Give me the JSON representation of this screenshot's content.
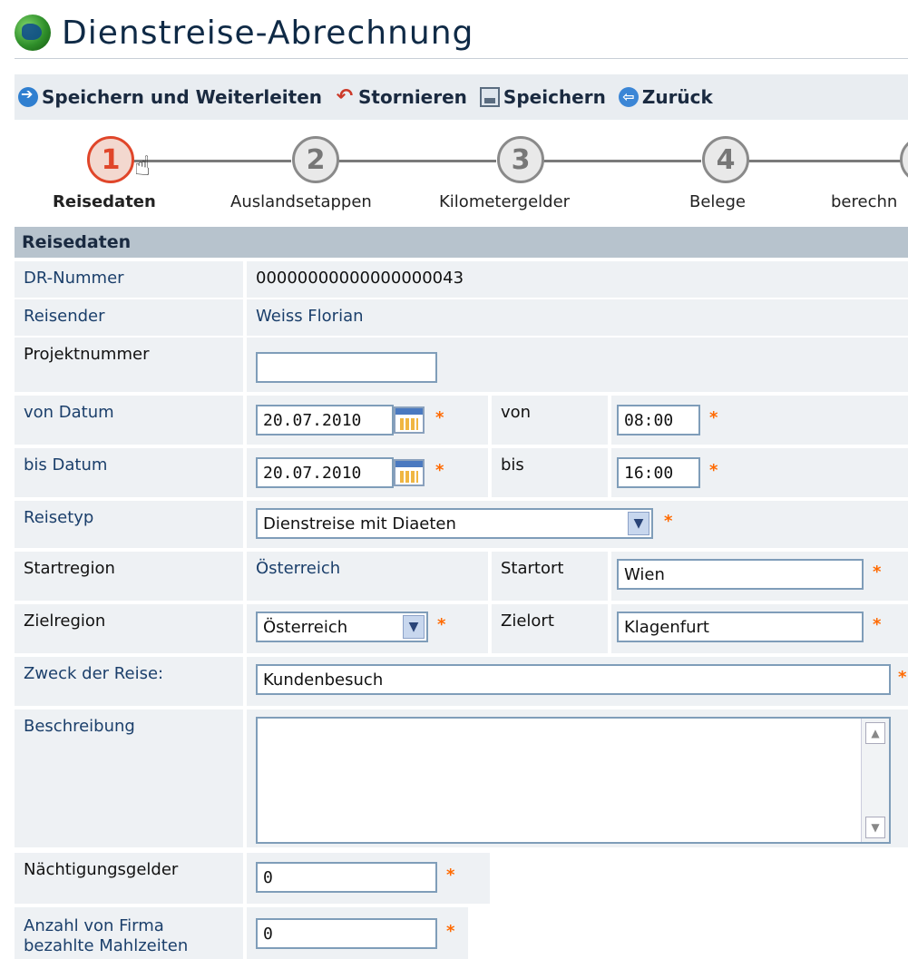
{
  "page": {
    "title": "Dienstreise-Abrechnung"
  },
  "toolbar": {
    "save_forward": "Speichern und Weiterleiten",
    "cancel": "Stornieren",
    "save": "Speichern",
    "back": "Zurück"
  },
  "steps": [
    {
      "num": "1",
      "label": "Reisedaten"
    },
    {
      "num": "2",
      "label": "Auslandsetappen"
    },
    {
      "num": "3",
      "label": "Kilometergelder"
    },
    {
      "num": "4",
      "label": "Belege"
    },
    {
      "num": "",
      "label": "berechn"
    }
  ],
  "section": {
    "title": "Reisedaten"
  },
  "form": {
    "dr_label": "DR-Nummer",
    "dr_value": "00000000000000000043",
    "traveler_label": "Reisender",
    "traveler_value": "Weiss Florian",
    "project_label": "Projektnummer",
    "project_value": "",
    "from_date_label": "von Datum",
    "from_date_value": "20.07.2010",
    "from_time_label": "von",
    "from_time_value": "08:00",
    "to_date_label": "bis Datum",
    "to_date_value": "20.07.2010",
    "to_time_label": "bis",
    "to_time_value": "16:00",
    "trip_type_label": "Reisetyp",
    "trip_type_value": "Dienstreise mit Diaeten",
    "start_region_label": "Startregion",
    "start_region_value": "Österreich",
    "start_city_label": "Startort",
    "start_city_value": "Wien",
    "dest_region_label": "Zielregion",
    "dest_region_value": "Österreich",
    "dest_city_label": "Zielort",
    "dest_city_value": "Klagenfurt",
    "purpose_label": "Zweck der Reise:",
    "purpose_value": "Kundenbesuch",
    "description_label": "Beschreibung",
    "description_value": "",
    "lodging_label": "Nächtigungsgelder",
    "lodging_value": "0",
    "meals_label_1": "Anzahl von Firma",
    "meals_label_2": "bezahlte Mahlzeiten",
    "meals_value": "0",
    "required_mark": "*"
  },
  "colors": {
    "accent": "#e0462a",
    "required": "#ff6a00",
    "label": "#1b3f6b",
    "header_bg": "#b7c3cd"
  }
}
